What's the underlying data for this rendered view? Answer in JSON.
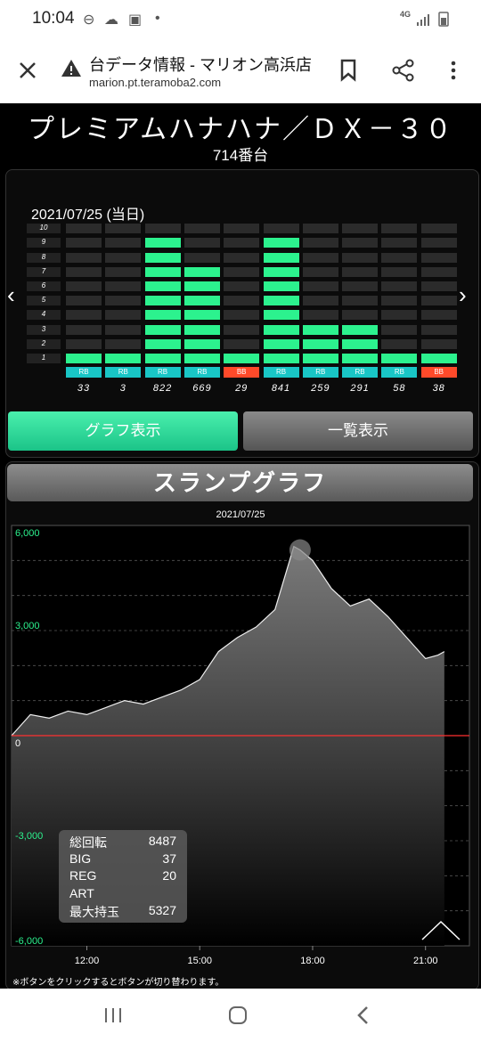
{
  "status": {
    "time": "10:04",
    "network": "4G"
  },
  "browser": {
    "title": "台データ情報 - マリオン高浜店",
    "url": "marion.pt.teramoba2.com"
  },
  "header": {
    "machine_name": "プレミアムハナハナ／ＤＸ－３０",
    "machine_number": "714番台"
  },
  "panel": {
    "date": "2021/07/25 (当日)",
    "level_labels": [
      "10",
      "9",
      "8",
      "7",
      "6",
      "5",
      "4",
      "3",
      "2",
      "1"
    ],
    "columns": [
      {
        "level": 1,
        "badge": "RB",
        "count": "33"
      },
      {
        "level": 1,
        "badge": "RB",
        "count": "3"
      },
      {
        "level": 9,
        "badge": "RB",
        "count": "822"
      },
      {
        "level": 7,
        "badge": "RB",
        "count": "669"
      },
      {
        "level": 1,
        "badge": "BB",
        "count": "29"
      },
      {
        "level": 9,
        "badge": "RB",
        "count": "841"
      },
      {
        "level": 3,
        "badge": "RB",
        "count": "259"
      },
      {
        "level": 3,
        "badge": "RB",
        "count": "291"
      },
      {
        "level": 1,
        "badge": "RB",
        "count": "58"
      },
      {
        "level": 1,
        "badge": "BB",
        "count": "38"
      }
    ],
    "graph_button": "グラフ表示",
    "list_button": "一覧表示"
  },
  "slump": {
    "title": "スランプグラフ",
    "chart_data": {
      "type": "area",
      "title": "2021/07/25",
      "y_ticks": [
        "6,000",
        "3,000",
        "0",
        "-3,000",
        "-6,000"
      ],
      "x_ticks": [
        "12:00",
        "15:00",
        "18:00",
        "21:00"
      ],
      "ylim": [
        -6000,
        6000
      ],
      "xlim": [
        "10:00",
        "22:10"
      ],
      "x": [
        "10:00",
        "10:30",
        "11:00",
        "11:30",
        "12:00",
        "12:30",
        "13:00",
        "13:30",
        "14:00",
        "14:30",
        "15:00",
        "15:30",
        "16:00",
        "16:30",
        "17:00",
        "17:30",
        "17:40",
        "18:00",
        "18:30",
        "19:00",
        "19:30",
        "20:00",
        "20:30",
        "21:00",
        "21:20",
        "21:30"
      ],
      "y": [
        0,
        600,
        500,
        700,
        600,
        800,
        1000,
        900,
        1100,
        1300,
        1600,
        2400,
        2800,
        3100,
        3600,
        5400,
        5300,
        5000,
        4200,
        3700,
        3900,
        3400,
        2800,
        2200,
        2300,
        2400
      ],
      "peak_marker_x": "17:40",
      "colors": {
        "positive_label": "#2cf28e",
        "zero_line": "#ff3030",
        "area": "#777777"
      }
    },
    "stats": [
      {
        "label": "総回転",
        "value": "8487"
      },
      {
        "label": "BIG",
        "value": "37"
      },
      {
        "label": "REG",
        "value": "20"
      },
      {
        "label": "ART",
        "value": ""
      },
      {
        "label": "最大持玉",
        "value": "5327"
      }
    ]
  },
  "footer_note": "※ボタンをクリックするとボタンが切り替わります。",
  "colors": {
    "accent_green": "#2cf28e",
    "rb_badge": "#19c6c6",
    "bb_badge": "#ff4a2a"
  }
}
